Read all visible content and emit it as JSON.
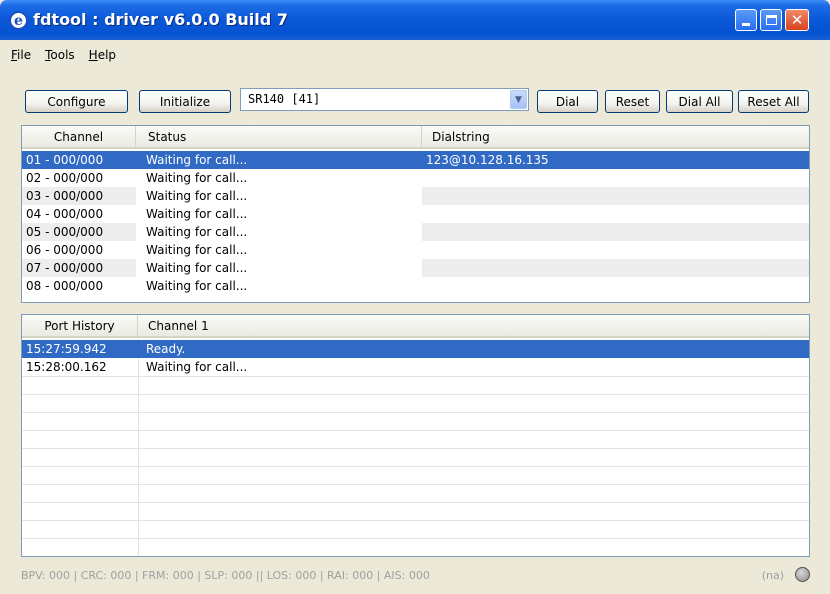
{
  "window": {
    "title": "fdtool : driver v6.0.0 Build 7",
    "app_icon": "e-icon",
    "close_glyph": "✕"
  },
  "menu": [
    {
      "label_ul": "F",
      "label_rest": "ile"
    },
    {
      "label_ul": "T",
      "label_rest": "ools"
    },
    {
      "label_ul": "H",
      "label_rest": "elp"
    }
  ],
  "toolbar": {
    "configure": "Configure",
    "initialize": "Initialize",
    "device_select": "SR140 [41]",
    "dropdown_arrow": "▼",
    "dial": "Dial",
    "reset": "Reset",
    "dial_all": "Dial All",
    "reset_all": "Reset All"
  },
  "channels": {
    "columns": [
      "Channel",
      "Status",
      "Dialstring"
    ],
    "rows": [
      {
        "channel": "01 - 000/000",
        "status": "Waiting for call...",
        "dialstring": "123@10.128.16.135"
      },
      {
        "channel": "02 - 000/000",
        "status": "Waiting for call...",
        "dialstring": ""
      },
      {
        "channel": "03 - 000/000",
        "status": "Waiting for call...",
        "dialstring": ""
      },
      {
        "channel": "04 - 000/000",
        "status": "Waiting for call...",
        "dialstring": ""
      },
      {
        "channel": "05 - 000/000",
        "status": "Waiting for call...",
        "dialstring": ""
      },
      {
        "channel": "06 - 000/000",
        "status": "Waiting for call...",
        "dialstring": ""
      },
      {
        "channel": "07 - 000/000",
        "status": "Waiting for call...",
        "dialstring": ""
      },
      {
        "channel": "08 - 000/000",
        "status": "Waiting for call...",
        "dialstring": ""
      }
    ]
  },
  "history": {
    "columns": [
      "Port History",
      "Channel 1"
    ],
    "rows": [
      {
        "time": "15:27:59.942",
        "message": "Ready."
      },
      {
        "time": "15:28:00.162",
        "message": "Waiting for call..."
      }
    ]
  },
  "status_bar": {
    "text": "BPV: 000 | CRC: 000 | FRM: 000 | SLP: 000 || LOS: 000 | RAI: 000 | AIS: 000",
    "na": "(na)"
  },
  "colors": {
    "title_bar": "#0a58d8",
    "selection": "#316ac5",
    "window_bg": "#ece9d8"
  }
}
